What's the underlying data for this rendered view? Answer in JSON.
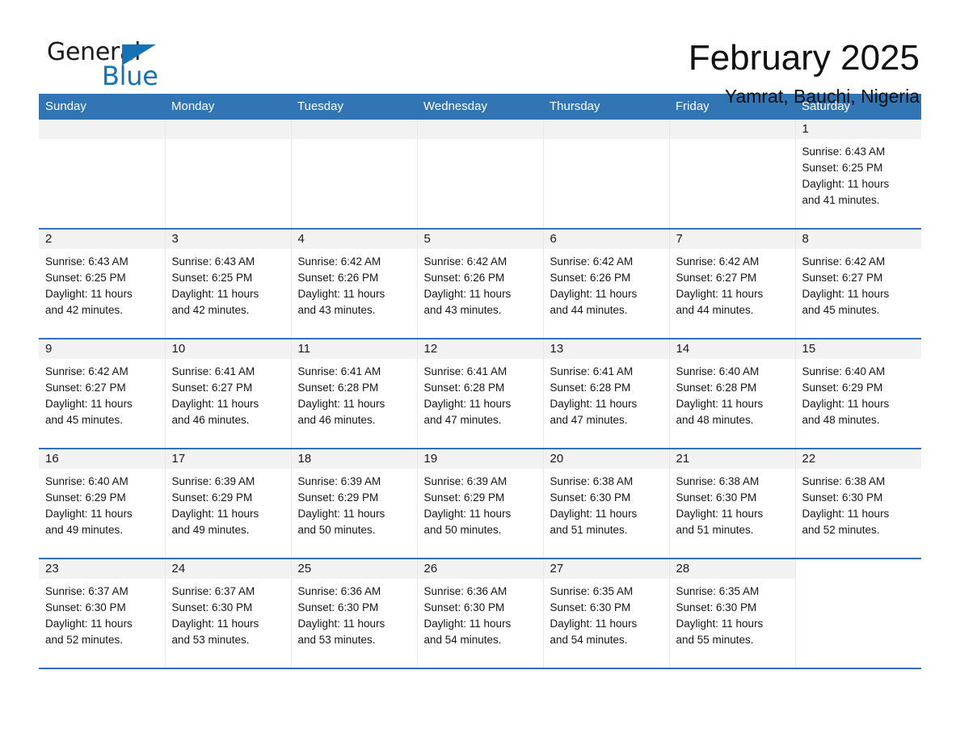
{
  "brand": {
    "name_part1": "General",
    "name_part2": "Blue",
    "logo_icon": "triangle-logo-icon",
    "accent_color": "#1372b8"
  },
  "header": {
    "month_title": "February 2025",
    "location": "Yamrat, Bauchi, Nigeria"
  },
  "theme": {
    "header_blue": "#3275b4",
    "row_divider_blue": "#3275b4",
    "daynum_band_gray": "#f2f2f2"
  },
  "calendar": {
    "weekday_headers": [
      "Sunday",
      "Monday",
      "Tuesday",
      "Wednesday",
      "Thursday",
      "Friday",
      "Saturday"
    ],
    "weeks": [
      [
        {
          "day": "",
          "lines": []
        },
        {
          "day": "",
          "lines": []
        },
        {
          "day": "",
          "lines": []
        },
        {
          "day": "",
          "lines": []
        },
        {
          "day": "",
          "lines": []
        },
        {
          "day": "",
          "lines": []
        },
        {
          "day": "1",
          "lines": [
            "Sunrise: 6:43 AM",
            "Sunset: 6:25 PM",
            "Daylight: 11 hours",
            "and 41 minutes."
          ]
        }
      ],
      [
        {
          "day": "2",
          "lines": [
            "Sunrise: 6:43 AM",
            "Sunset: 6:25 PM",
            "Daylight: 11 hours",
            "and 42 minutes."
          ]
        },
        {
          "day": "3",
          "lines": [
            "Sunrise: 6:43 AM",
            "Sunset: 6:25 PM",
            "Daylight: 11 hours",
            "and 42 minutes."
          ]
        },
        {
          "day": "4",
          "lines": [
            "Sunrise: 6:42 AM",
            "Sunset: 6:26 PM",
            "Daylight: 11 hours",
            "and 43 minutes."
          ]
        },
        {
          "day": "5",
          "lines": [
            "Sunrise: 6:42 AM",
            "Sunset: 6:26 PM",
            "Daylight: 11 hours",
            "and 43 minutes."
          ]
        },
        {
          "day": "6",
          "lines": [
            "Sunrise: 6:42 AM",
            "Sunset: 6:26 PM",
            "Daylight: 11 hours",
            "and 44 minutes."
          ]
        },
        {
          "day": "7",
          "lines": [
            "Sunrise: 6:42 AM",
            "Sunset: 6:27 PM",
            "Daylight: 11 hours",
            "and 44 minutes."
          ]
        },
        {
          "day": "8",
          "lines": [
            "Sunrise: 6:42 AM",
            "Sunset: 6:27 PM",
            "Daylight: 11 hours",
            "and 45 minutes."
          ]
        }
      ],
      [
        {
          "day": "9",
          "lines": [
            "Sunrise: 6:42 AM",
            "Sunset: 6:27 PM",
            "Daylight: 11 hours",
            "and 45 minutes."
          ]
        },
        {
          "day": "10",
          "lines": [
            "Sunrise: 6:41 AM",
            "Sunset: 6:27 PM",
            "Daylight: 11 hours",
            "and 46 minutes."
          ]
        },
        {
          "day": "11",
          "lines": [
            "Sunrise: 6:41 AM",
            "Sunset: 6:28 PM",
            "Daylight: 11 hours",
            "and 46 minutes."
          ]
        },
        {
          "day": "12",
          "lines": [
            "Sunrise: 6:41 AM",
            "Sunset: 6:28 PM",
            "Daylight: 11 hours",
            "and 47 minutes."
          ]
        },
        {
          "day": "13",
          "lines": [
            "Sunrise: 6:41 AM",
            "Sunset: 6:28 PM",
            "Daylight: 11 hours",
            "and 47 minutes."
          ]
        },
        {
          "day": "14",
          "lines": [
            "Sunrise: 6:40 AM",
            "Sunset: 6:28 PM",
            "Daylight: 11 hours",
            "and 48 minutes."
          ]
        },
        {
          "day": "15",
          "lines": [
            "Sunrise: 6:40 AM",
            "Sunset: 6:29 PM",
            "Daylight: 11 hours",
            "and 48 minutes."
          ]
        }
      ],
      [
        {
          "day": "16",
          "lines": [
            "Sunrise: 6:40 AM",
            "Sunset: 6:29 PM",
            "Daylight: 11 hours",
            "and 49 minutes."
          ]
        },
        {
          "day": "17",
          "lines": [
            "Sunrise: 6:39 AM",
            "Sunset: 6:29 PM",
            "Daylight: 11 hours",
            "and 49 minutes."
          ]
        },
        {
          "day": "18",
          "lines": [
            "Sunrise: 6:39 AM",
            "Sunset: 6:29 PM",
            "Daylight: 11 hours",
            "and 50 minutes."
          ]
        },
        {
          "day": "19",
          "lines": [
            "Sunrise: 6:39 AM",
            "Sunset: 6:29 PM",
            "Daylight: 11 hours",
            "and 50 minutes."
          ]
        },
        {
          "day": "20",
          "lines": [
            "Sunrise: 6:38 AM",
            "Sunset: 6:30 PM",
            "Daylight: 11 hours",
            "and 51 minutes."
          ]
        },
        {
          "day": "21",
          "lines": [
            "Sunrise: 6:38 AM",
            "Sunset: 6:30 PM",
            "Daylight: 11 hours",
            "and 51 minutes."
          ]
        },
        {
          "day": "22",
          "lines": [
            "Sunrise: 6:38 AM",
            "Sunset: 6:30 PM",
            "Daylight: 11 hours",
            "and 52 minutes."
          ]
        }
      ],
      [
        {
          "day": "23",
          "lines": [
            "Sunrise: 6:37 AM",
            "Sunset: 6:30 PM",
            "Daylight: 11 hours",
            "and 52 minutes."
          ]
        },
        {
          "day": "24",
          "lines": [
            "Sunrise: 6:37 AM",
            "Sunset: 6:30 PM",
            "Daylight: 11 hours",
            "and 53 minutes."
          ]
        },
        {
          "day": "25",
          "lines": [
            "Sunrise: 6:36 AM",
            "Sunset: 6:30 PM",
            "Daylight: 11 hours",
            "and 53 minutes."
          ]
        },
        {
          "day": "26",
          "lines": [
            "Sunrise: 6:36 AM",
            "Sunset: 6:30 PM",
            "Daylight: 11 hours",
            "and 54 minutes."
          ]
        },
        {
          "day": "27",
          "lines": [
            "Sunrise: 6:35 AM",
            "Sunset: 6:30 PM",
            "Daylight: 11 hours",
            "and 54 minutes."
          ]
        },
        {
          "day": "28",
          "lines": [
            "Sunrise: 6:35 AM",
            "Sunset: 6:30 PM",
            "Daylight: 11 hours",
            "and 55 minutes."
          ]
        },
        {
          "day": "",
          "lines": []
        }
      ]
    ]
  }
}
